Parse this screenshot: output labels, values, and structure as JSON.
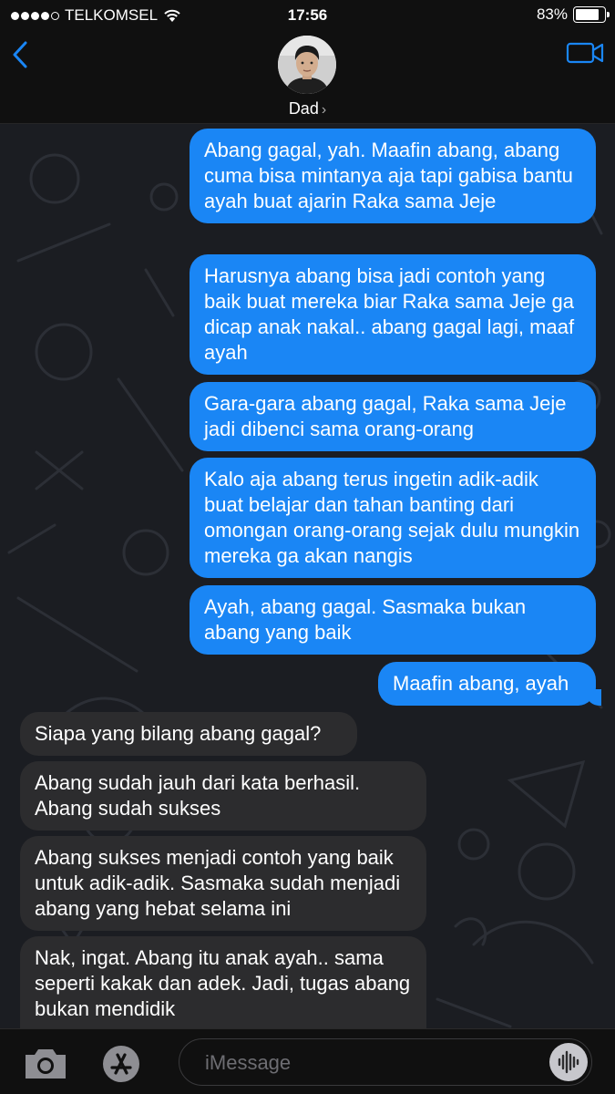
{
  "status": {
    "carrier": "TELKOMSEL",
    "time": "17:56",
    "battery_percent": "83%",
    "battery_level": 0.83
  },
  "header": {
    "contact_name": "Dad",
    "chevron": "›",
    "back_icon": "chevron-left-icon",
    "video_icon": "video-camera-icon"
  },
  "messages": [
    {
      "side": "sent",
      "text": "Abang gagal, yah. Maafin abang, abang cuma bisa mintanya aja tapi gabisa bantu ayah buat ajarin Raka sama Jeje"
    },
    {
      "side": "sent",
      "text": "Harusnya abang bisa jadi contoh yang baik buat mereka biar Raka sama Jeje ga dicap anak nakal.. abang gagal lagi, maaf ayah"
    },
    {
      "side": "sent",
      "text": "Gara-gara abang gagal, Raka sama Jeje jadi dibenci sama orang-orang"
    },
    {
      "side": "sent",
      "text": "Kalo aja abang terus ingetin adik-adik buat belajar dan tahan banting dari omongan orang-orang sejak dulu mungkin mereka ga akan nangis"
    },
    {
      "side": "sent",
      "text": "Ayah, abang gagal. Sasmaka bukan abang yang baik"
    },
    {
      "side": "sent",
      "text": "Maafin abang, ayah"
    },
    {
      "side": "received",
      "text": "Siapa yang bilang abang gagal?"
    },
    {
      "side": "received",
      "text": "Abang sudah jauh dari kata berhasil. Abang sudah sukses"
    },
    {
      "side": "received",
      "text": "Abang sukses menjadi contoh yang baik untuk adik-adik. Sasmaka sudah menjadi abang yang hebat selama ini"
    },
    {
      "side": "received",
      "text": "Nak, ingat. Abang itu anak ayah.. sama seperti kakak dan adek. Jadi, tugas abang bukan mendidik"
    }
  ],
  "input": {
    "placeholder": "iMessage",
    "camera_icon": "camera-icon",
    "apps_icon": "app-store-icon",
    "voice_icon": "audio-waveform-icon"
  },
  "colors": {
    "sent_bubble": "#1a86f5",
    "received_bubble": "#2c2c2e",
    "accent": "#1a86f5"
  }
}
